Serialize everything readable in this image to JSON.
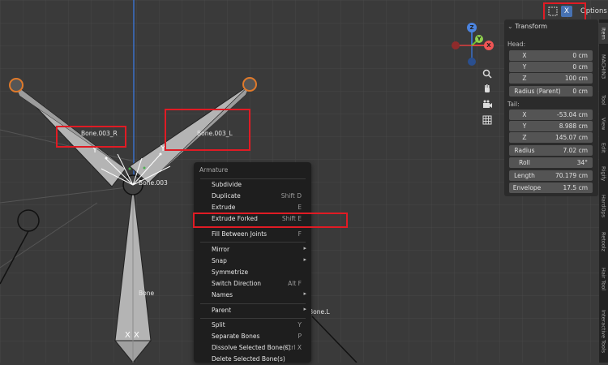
{
  "viewport": {
    "bones": [
      {
        "name": "Bone.003_R"
      },
      {
        "name": "Bone.003_L"
      },
      {
        "name": "Bone.003"
      },
      {
        "name": "Bone"
      },
      {
        "name": "Bone.L"
      }
    ]
  },
  "header": {
    "x_toggle_label": "X",
    "options_label": "Options"
  },
  "gizmo": {
    "z": "Z",
    "y": "Y",
    "x": "X"
  },
  "npanel": {
    "title": "Transform",
    "head_label": "Head:",
    "head": [
      {
        "label": "X",
        "value": "0 cm"
      },
      {
        "label": "Y",
        "value": "0 cm"
      },
      {
        "label": "Z",
        "value": "100 cm"
      },
      {
        "label": "Radius (Parent)",
        "value": "0 cm"
      }
    ],
    "tail_label": "Tail:",
    "tail": [
      {
        "label": "X",
        "value": "-53.04 cm"
      },
      {
        "label": "Y",
        "value": "8.988 cm"
      },
      {
        "label": "Z",
        "value": "145.07 cm"
      }
    ],
    "props": [
      {
        "label": "Radius",
        "value": "7.02 cm"
      },
      {
        "label": "Roll",
        "value": "34°"
      },
      {
        "label": "Length",
        "value": "70.179 cm"
      },
      {
        "label": "Envelope",
        "value": "17.5 cm"
      }
    ]
  },
  "side_tabs": [
    "Item",
    "MACHIN3",
    "Tool",
    "View",
    "Edit",
    "Rigify",
    "HardOps",
    "Retoolz",
    "Hair Tool",
    "Interactive Tools"
  ],
  "context_menu": {
    "title": "Armature",
    "items": [
      {
        "label": "Subdivide",
        "shortcut": ""
      },
      {
        "label": "Duplicate",
        "shortcut": "Shift D"
      },
      {
        "label": "Extrude",
        "shortcut": "E"
      },
      {
        "label": "Extrude Forked",
        "shortcut": "Shift E"
      },
      {
        "label": "Fill Between Joints",
        "shortcut": "F"
      },
      {
        "label": "Mirror",
        "shortcut": ""
      },
      {
        "label": "Snap",
        "shortcut": ""
      },
      {
        "label": "Symmetrize",
        "shortcut": ""
      },
      {
        "label": "Switch Direction",
        "shortcut": "Alt F"
      },
      {
        "label": "Names",
        "shortcut": ""
      },
      {
        "label": "Parent",
        "shortcut": ""
      },
      {
        "label": "Split",
        "shortcut": "Y"
      },
      {
        "label": "Separate Bones",
        "shortcut": "P"
      },
      {
        "label": "Dissolve Selected Bone(s)",
        "shortcut": "Ctrl X"
      },
      {
        "label": "Delete Selected Bone(s)",
        "shortcut": ""
      }
    ]
  },
  "colors": {
    "highlight_box": "#e01b24",
    "accent": "#4772b3",
    "bone_fill": "#b4b4b4",
    "joint_orange": "#e07a2b"
  }
}
